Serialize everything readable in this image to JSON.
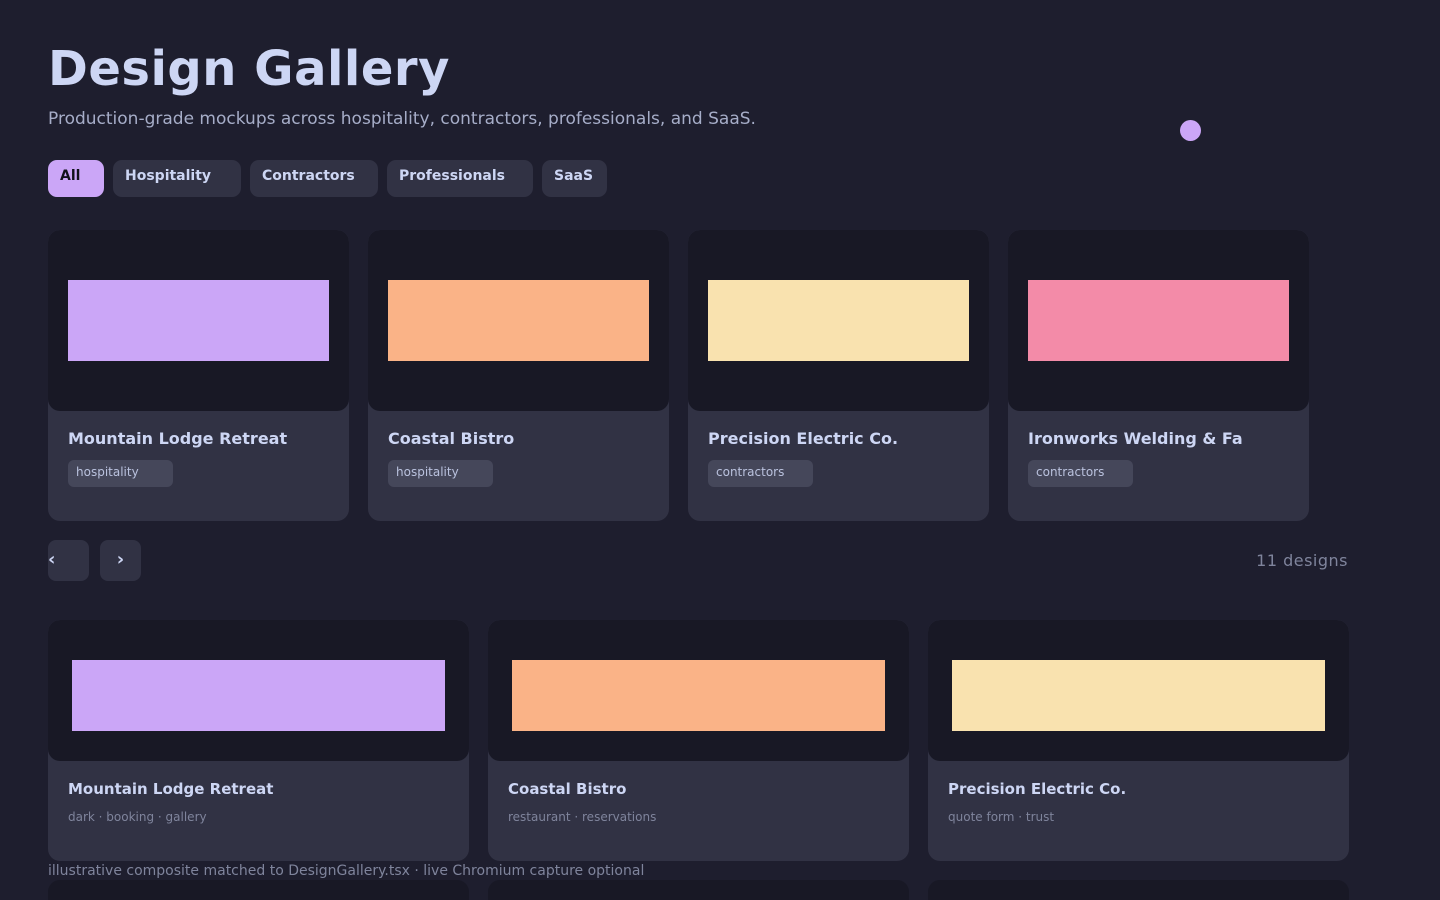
{
  "header": {
    "title": "Design Gallery",
    "subtitle": "Production-grade mockups across hospitality, contractors, professionals, and SaaS."
  },
  "filters": [
    {
      "label": "All",
      "active": true
    },
    {
      "label": "Hospitality",
      "active": false
    },
    {
      "label": "Contractors",
      "active": false
    },
    {
      "label": "Professionals",
      "active": false
    },
    {
      "label": "SaaS",
      "active": false
    }
  ],
  "carousel": {
    "cards": [
      {
        "title": "Mountain Lodge Retreat",
        "tag": "hospitality",
        "color": "#cba6f7"
      },
      {
        "title": "Coastal Bistro",
        "tag": "hospitality",
        "color": "#fab387"
      },
      {
        "title": "Precision Electric Co.",
        "tag": "contractors",
        "color": "#f9e2af"
      },
      {
        "title": "Ironworks Welding & Fa",
        "tag": "contractors",
        "color": "#f38ba8"
      }
    ],
    "prev_icon": "‹",
    "next_icon": "›",
    "count_text": "11 designs"
  },
  "grid": {
    "cards": [
      {
        "title": "Mountain Lodge Retreat",
        "meta": "dark · booking · gallery",
        "color": "#cba6f7"
      },
      {
        "title": "Coastal Bistro",
        "meta": "restaurant · reservations",
        "color": "#fab387"
      },
      {
        "title": "Precision Electric Co.",
        "meta": "quote form · trust",
        "color": "#f9e2af"
      }
    ]
  },
  "footer": {
    "note": "illustrative composite matched to DesignGallery.tsx · live Chromium capture optional"
  },
  "colors": {
    "background": "#1e1e2e",
    "card": "#313244",
    "thumb": "#181825",
    "accent": "#cba6f7",
    "text": "#cdd6f4"
  }
}
